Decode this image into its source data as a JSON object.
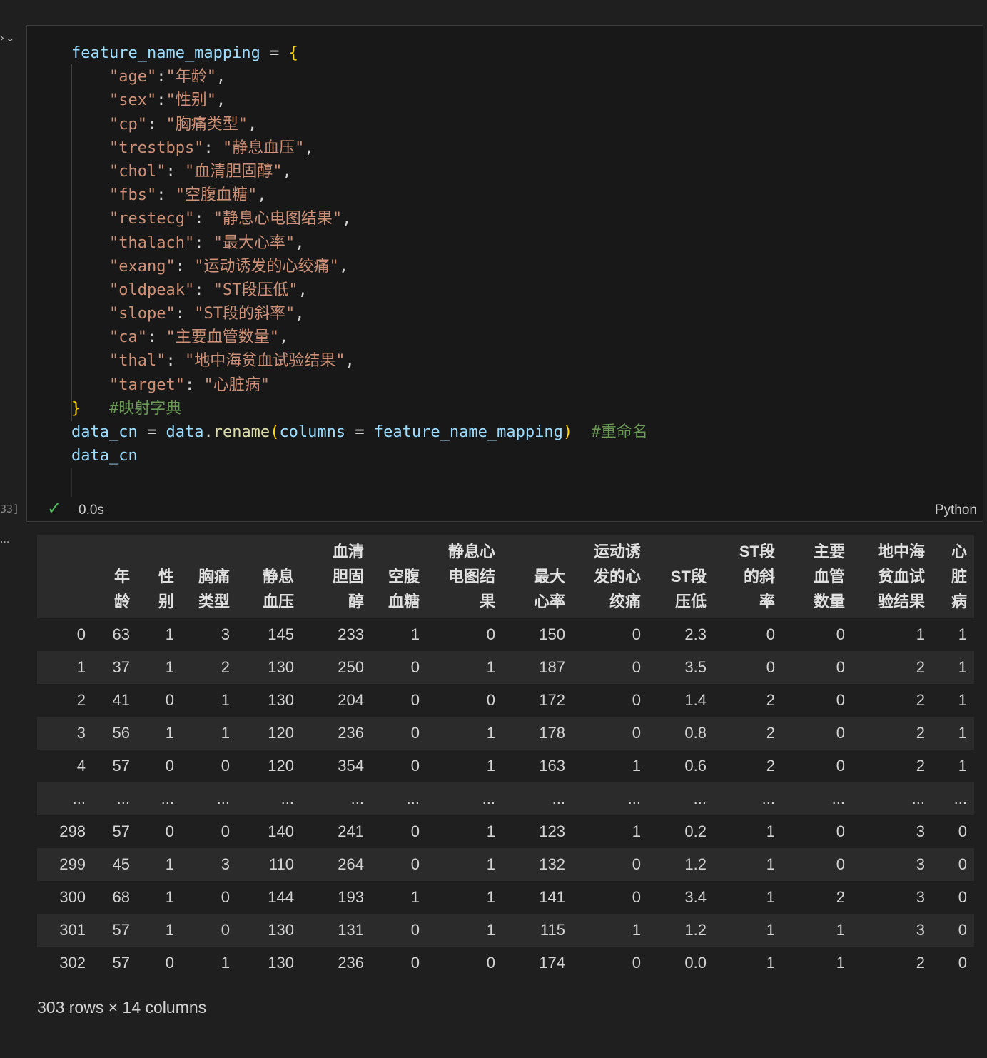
{
  "cell": {
    "execution_count": "33]",
    "exec_time": "0.0s",
    "kernel": "Python",
    "code_lines": [
      [
        [
          "var",
          "feature_name_mapping"
        ],
        [
          "op",
          " = "
        ],
        [
          "brace",
          "{"
        ]
      ],
      [
        [
          "str",
          "    \"age\""
        ],
        [
          "plain",
          ":"
        ],
        [
          "str",
          "\"年龄\""
        ],
        [
          "plain",
          ","
        ]
      ],
      [
        [
          "str",
          "    \"sex\""
        ],
        [
          "plain",
          ":"
        ],
        [
          "str",
          "\"性别\""
        ],
        [
          "plain",
          ","
        ]
      ],
      [
        [
          "str",
          "    \"cp\""
        ],
        [
          "plain",
          ": "
        ],
        [
          "str",
          "\"胸痛类型\""
        ],
        [
          "plain",
          ","
        ]
      ],
      [
        [
          "str",
          "    \"trestbps\""
        ],
        [
          "plain",
          ": "
        ],
        [
          "str",
          "\"静息血压\""
        ],
        [
          "plain",
          ","
        ]
      ],
      [
        [
          "str",
          "    \"chol\""
        ],
        [
          "plain",
          ": "
        ],
        [
          "str",
          "\"血清胆固醇\""
        ],
        [
          "plain",
          ","
        ]
      ],
      [
        [
          "str",
          "    \"fbs\""
        ],
        [
          "plain",
          ": "
        ],
        [
          "str",
          "\"空腹血糖\""
        ],
        [
          "plain",
          ","
        ]
      ],
      [
        [
          "str",
          "    \"restecg\""
        ],
        [
          "plain",
          ": "
        ],
        [
          "str",
          "\"静息心电图结果\""
        ],
        [
          "plain",
          ","
        ]
      ],
      [
        [
          "str",
          "    \"thalach\""
        ],
        [
          "plain",
          ": "
        ],
        [
          "str",
          "\"最大心率\""
        ],
        [
          "plain",
          ","
        ]
      ],
      [
        [
          "str",
          "    \"exang\""
        ],
        [
          "plain",
          ": "
        ],
        [
          "str",
          "\"运动诱发的心绞痛\""
        ],
        [
          "plain",
          ","
        ]
      ],
      [
        [
          "str",
          "    \"oldpeak\""
        ],
        [
          "plain",
          ": "
        ],
        [
          "str",
          "\"ST段压低\""
        ],
        [
          "plain",
          ","
        ]
      ],
      [
        [
          "str",
          "    \"slope\""
        ],
        [
          "plain",
          ": "
        ],
        [
          "str",
          "\"ST段的斜率\""
        ],
        [
          "plain",
          ","
        ]
      ],
      [
        [
          "str",
          "    \"ca\""
        ],
        [
          "plain",
          ": "
        ],
        [
          "str",
          "\"主要血管数量\""
        ],
        [
          "plain",
          ","
        ]
      ],
      [
        [
          "str",
          "    \"thal\""
        ],
        [
          "plain",
          ": "
        ],
        [
          "str",
          "\"地中海贫血试验结果\""
        ],
        [
          "plain",
          ","
        ]
      ],
      [
        [
          "str",
          "    \"target\""
        ],
        [
          "plain",
          ": "
        ],
        [
          "str",
          "\"心脏病\""
        ]
      ],
      [
        [
          "brace",
          "}"
        ],
        [
          "plain",
          "   "
        ],
        [
          "cmt",
          "#映射字典"
        ]
      ],
      [
        [
          "var",
          "data_cn"
        ],
        [
          "op",
          " = "
        ],
        [
          "var",
          "data"
        ],
        [
          "op",
          "."
        ],
        [
          "fn",
          "rename"
        ],
        [
          "brace",
          "("
        ],
        [
          "var",
          "columns"
        ],
        [
          "op",
          " = "
        ],
        [
          "var",
          "feature_name_mapping"
        ],
        [
          "brace",
          ")"
        ],
        [
          "plain",
          "  "
        ],
        [
          "cmt",
          "#重命名"
        ]
      ],
      [
        [
          "var",
          "data_cn"
        ]
      ]
    ]
  },
  "table": {
    "columns": [
      [
        ""
      ],
      [
        "年",
        "龄"
      ],
      [
        "性",
        "别"
      ],
      [
        "胸痛",
        "类型"
      ],
      [
        "静息",
        "血压"
      ],
      [
        "血清",
        "胆固",
        "醇"
      ],
      [
        "空腹",
        "血糖"
      ],
      [
        "静息心",
        "电图结",
        "果"
      ],
      [
        "最大",
        "心率"
      ],
      [
        "运动诱",
        "发的心",
        "绞痛"
      ],
      [
        "ST段",
        "压低"
      ],
      [
        "ST段",
        "的斜",
        "率"
      ],
      [
        "主要",
        "血管",
        "数量"
      ],
      [
        "地中海",
        "贫血试",
        "验结果"
      ],
      [
        "心",
        "脏",
        "病"
      ]
    ],
    "rows": [
      [
        "0",
        "63",
        "1",
        "3",
        "145",
        "233",
        "1",
        "0",
        "150",
        "0",
        "2.3",
        "0",
        "0",
        "1",
        "1"
      ],
      [
        "1",
        "37",
        "1",
        "2",
        "130",
        "250",
        "0",
        "1",
        "187",
        "0",
        "3.5",
        "0",
        "0",
        "2",
        "1"
      ],
      [
        "2",
        "41",
        "0",
        "1",
        "130",
        "204",
        "0",
        "0",
        "172",
        "0",
        "1.4",
        "2",
        "0",
        "2",
        "1"
      ],
      [
        "3",
        "56",
        "1",
        "1",
        "120",
        "236",
        "0",
        "1",
        "178",
        "0",
        "0.8",
        "2",
        "0",
        "2",
        "1"
      ],
      [
        "4",
        "57",
        "0",
        "0",
        "120",
        "354",
        "0",
        "1",
        "163",
        "1",
        "0.6",
        "2",
        "0",
        "2",
        "1"
      ],
      [
        "...",
        "...",
        "...",
        "...",
        "...",
        "...",
        "...",
        "...",
        "...",
        "...",
        "...",
        "...",
        "...",
        "...",
        "..."
      ],
      [
        "298",
        "57",
        "0",
        "0",
        "140",
        "241",
        "0",
        "1",
        "123",
        "1",
        "0.2",
        "1",
        "0",
        "3",
        "0"
      ],
      [
        "299",
        "45",
        "1",
        "3",
        "110",
        "264",
        "0",
        "1",
        "132",
        "0",
        "1.2",
        "1",
        "0",
        "3",
        "0"
      ],
      [
        "300",
        "68",
        "1",
        "0",
        "144",
        "193",
        "1",
        "1",
        "141",
        "0",
        "3.4",
        "1",
        "2",
        "3",
        "0"
      ],
      [
        "301",
        "57",
        "1",
        "0",
        "130",
        "131",
        "0",
        "1",
        "115",
        "1",
        "1.2",
        "1",
        "1",
        "3",
        "0"
      ],
      [
        "302",
        "57",
        "0",
        "1",
        "130",
        "236",
        "0",
        "0",
        "174",
        "0",
        "0.0",
        "1",
        "1",
        "2",
        "0"
      ]
    ],
    "shape_text": "303 rows × 14 columns"
  }
}
